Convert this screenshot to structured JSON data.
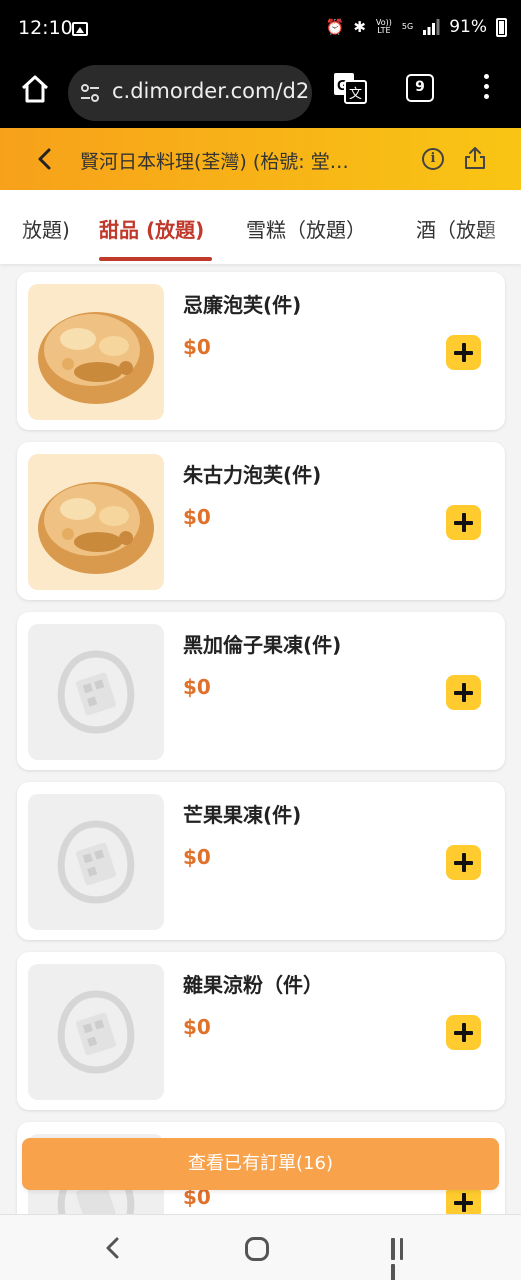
{
  "status_bar": {
    "time": "12:10",
    "volte_label": "Vo)) LTE",
    "network_label": "5G",
    "battery_text": "91%"
  },
  "browser": {
    "url": "c.dimorder.com/d2",
    "tab_count": "9"
  },
  "header": {
    "title": "賢河日本料理(荃灣) (枱號: 堂…",
    "accent_from": "#f7a11a",
    "accent_to": "#f9c514"
  },
  "tabs": [
    {
      "label": "放題)",
      "active": false
    },
    {
      "label": "甜品 (放題)",
      "active": true
    },
    {
      "label": "雪糕（放題）",
      "active": false
    },
    {
      "label": "酒（放題",
      "active": false
    }
  ],
  "menu_items": [
    {
      "name": "忌廉泡芙(件)",
      "price": "$0",
      "image": "cream-puff"
    },
    {
      "name": "朱古力泡芙(件)",
      "price": "$0",
      "image": "cream-puff"
    },
    {
      "name": "黑加倫子果凍(件)",
      "price": "$0",
      "image": "placeholder"
    },
    {
      "name": "芒果果凍(件)",
      "price": "$0",
      "image": "placeholder"
    },
    {
      "name": "雜果涼粉（件）",
      "price": "$0",
      "image": "placeholder"
    },
    {
      "name": "",
      "price": "$0",
      "image": "placeholder"
    }
  ],
  "view_orders_label": "查看已有訂單(16)",
  "colors": {
    "price": "#e0712a",
    "active_tab": "#c0392b",
    "add_button": "#ffcb2e",
    "view_orders": "#f8a24b"
  }
}
